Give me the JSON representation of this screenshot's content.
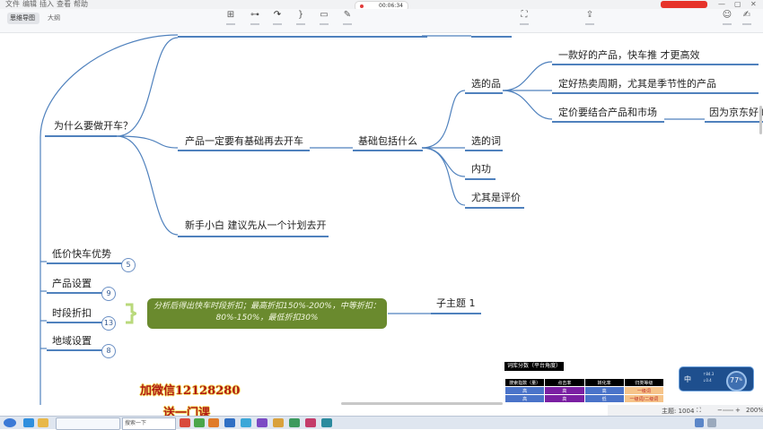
{
  "titlebar": {
    "menu": [
      "文件",
      "编辑",
      "插入",
      "查看",
      "帮助"
    ],
    "recording_time": "00:06:34",
    "window_controls": [
      "—",
      "▢",
      "✕"
    ]
  },
  "toolbar": {
    "tabs": [
      {
        "label": "思维导图",
        "active": true
      },
      {
        "label": "大纲",
        "active": false
      }
    ],
    "tools": [
      {
        "icon": "topic-icon",
        "glyph": "⊞"
      },
      {
        "icon": "subtopic-icon",
        "glyph": "⊶"
      },
      {
        "icon": "relation-icon",
        "glyph": "↷",
        "active": true
      },
      {
        "icon": "summary-icon",
        "glyph": "}"
      },
      {
        "icon": "boundary-icon",
        "glyph": "▭"
      },
      {
        "icon": "note-icon",
        "glyph": "✎"
      },
      {
        "icon": "zen-icon",
        "glyph": "⛶"
      },
      {
        "icon": "share-icon",
        "glyph": "⇪"
      },
      {
        "icon": "format-icon",
        "glyph": "✍"
      }
    ],
    "face_icon": "☺"
  },
  "mindmap": {
    "branches": [
      {
        "label": "为什么要做开车？"
      },
      {
        "label": "产品一定要有基础再去开车"
      },
      {
        "label": "新手小白 建议先从一个计划去开"
      },
      {
        "label": "基础包括什么"
      },
      {
        "label": "选的品"
      },
      {
        "label": "选的词"
      },
      {
        "label": "内功"
      },
      {
        "label": "尤其是评价"
      },
      {
        "label": "一款好的产品，快车推 才更高效"
      },
      {
        "label": "定好热卖周期，尤其是季节性的产品"
      },
      {
        "label": "定价要结合产品和市场"
      },
      {
        "label": "因为京东好的"
      }
    ],
    "topics": [
      {
        "label": "低价快车优势",
        "count": "5"
      },
      {
        "label": "产品设置",
        "count": "9"
      },
      {
        "label": "时段折扣",
        "count": "13"
      },
      {
        "label": "地域设置",
        "count": "8"
      }
    ],
    "note": "分析后得出快车时段折扣；最高折扣150%-200%，中等折扣：80%-150%，最低折扣30%",
    "subtopic": "子主题 1"
  },
  "overlay": {
    "promo_line1": "加微信12128280",
    "promo_line2": "送一门课",
    "table_title": "词库分数（平台角度）",
    "table_headers": [
      "搜索指数（量）",
      "点击率",
      "转化率",
      "归类等级"
    ],
    "table_rows": [
      [
        "高",
        "高",
        "高",
        "一级词"
      ],
      [
        "高",
        "高",
        "低",
        "一级词/二级词"
      ]
    ],
    "speed_value": "77",
    "speed_unit": "%",
    "speed_label": "中",
    "speed_up": "↑84.3",
    "speed_down": "↓0.4"
  },
  "statusbar": {
    "topic_count": "主题: 1004",
    "zoom": "200%",
    "zoom_minus": "−",
    "zoom_plus": "+",
    "fit": "⛶"
  },
  "taskbar": {
    "start_icon": "windows-start-icon",
    "search_placeholder": "搜索一下"
  },
  "colors": {
    "branch_line": "#4f81bd",
    "note_bg": "#6a8a2e",
    "bracket": "#b9d97b",
    "promo_text": "#b11a12",
    "promo_outline": "#f7e46a",
    "table_blue": "#4a73c9",
    "table_purple": "#7a1fa2",
    "table_orange": "#f6c48a"
  }
}
